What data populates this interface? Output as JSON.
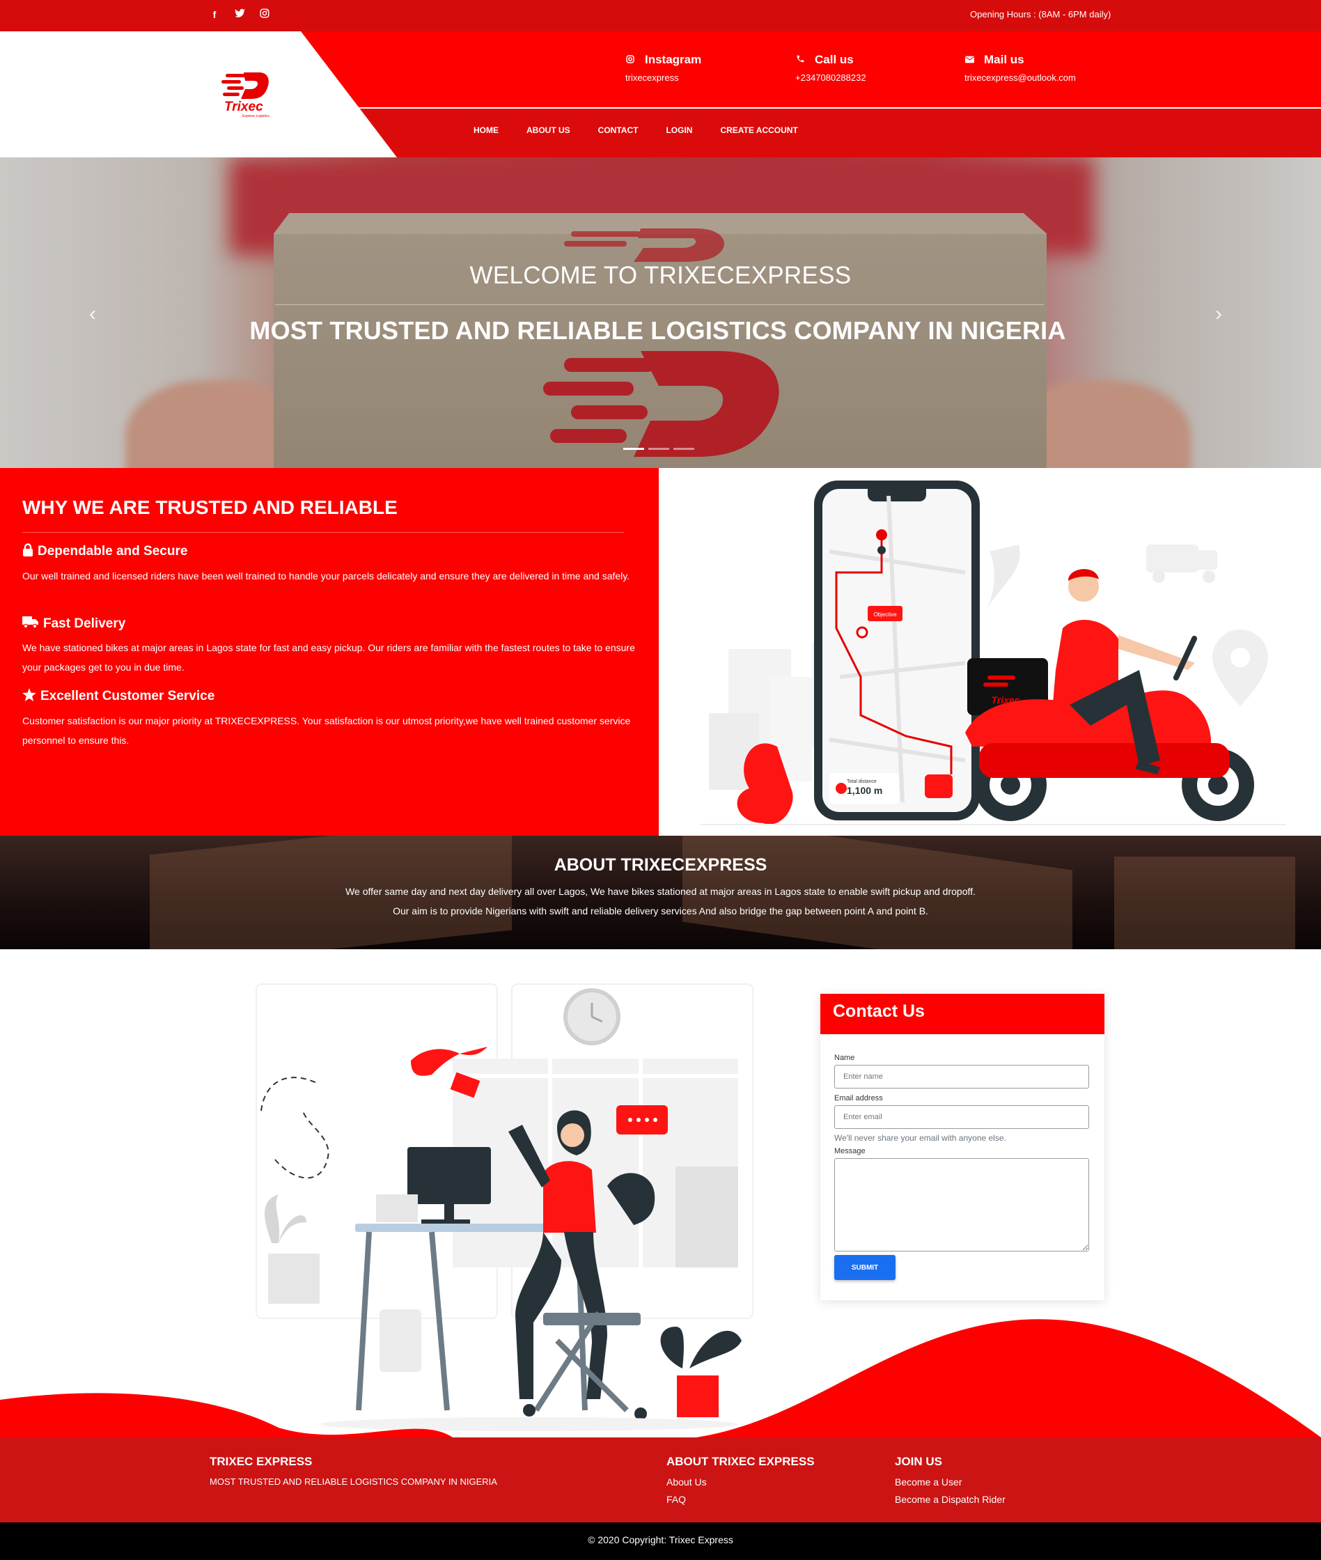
{
  "topbar": {
    "socials": [
      "facebook-icon",
      "twitter-icon",
      "instagram-icon"
    ],
    "opening_hours": "Opening Hours : (8AM - 6PM daily)"
  },
  "brand": {
    "name": "Trixec",
    "tagline": "Express Logistics"
  },
  "contacts": [
    {
      "icon": "instagram-icon",
      "title": "Instagram",
      "value": "trixecexpress"
    },
    {
      "icon": "phone-icon",
      "title": "Call us",
      "value": "+2347080288232"
    },
    {
      "icon": "envelope-icon",
      "title": "Mail us",
      "value": "trixecexpress@outlook.com"
    }
  ],
  "nav": [
    "HOME",
    "ABOUT US",
    "CONTACT",
    "LOGIN",
    "CREATE ACCOUNT"
  ],
  "hero": {
    "title": "WELCOME TO TRIXECEXPRESS",
    "subtitle": "MOST TRUSTED AND RELIABLE LOGISTICS COMPANY IN NIGERIA",
    "prev": "‹",
    "next": "›",
    "active_slide": 1,
    "slide_count": 3
  },
  "why": {
    "title": "WHY WE ARE TRUSTED AND RELIABLE",
    "items": [
      {
        "icon": "lock-icon",
        "title": "Dependable and Secure",
        "text": "Our well trained and licensed riders have been well trained to handle your parcels delicately and ensure they are delivered in time and safely."
      },
      {
        "icon": "truck-icon",
        "title": "Fast Delivery",
        "text": "We have stationed bikes at major areas in Lagos state for fast and easy pickup. Our riders are familiar with the fastest routes to take to ensure your packages get to you in due time."
      },
      {
        "icon": "star-icon",
        "title": "Excellent Customer Service",
        "text": "Customer satisfaction is our major priority at TRIXECEXPRESS. Your satisfaction is our utmost priority,we have well trained customer service personnel to ensure this."
      }
    ],
    "illustration": {
      "label": "Objective",
      "distance_label": "Total distance",
      "distance": "1,100 m",
      "brand": "Trixec"
    }
  },
  "about": {
    "title": "ABOUT TRIXECEXPRESS",
    "line1": "We offer same day and next day delivery all over Lagos, We have bikes stationed at major areas in Lagos state to enable swift pickup and dropoff.",
    "line2": "Our aim is to provide Nigerians with swift and reliable delivery services And also bridge the gap between point A and point B."
  },
  "contact_form": {
    "title": "Contact Us",
    "name_label": "Name",
    "name_placeholder": "Enter name",
    "email_label": "Email address",
    "email_placeholder": "Enter email",
    "email_hint": "We'll never share your email with anyone else.",
    "message_label": "Message",
    "submit": "SUBMIT"
  },
  "footer": {
    "col1": {
      "title": "TRIXEC EXPRESS",
      "text": "MOST TRUSTED AND RELIABLE LOGISTICS COMPANY IN NIGERIA"
    },
    "col2": {
      "title": "ABOUT TRIXEC EXPRESS",
      "links": [
        "About Us",
        "FAQ"
      ]
    },
    "col3": {
      "title": "JOIN US",
      "links": [
        "Become a User",
        "Become a Dispatch Rider"
      ]
    },
    "copyright": "© 2020 Copyright: Trixec Express"
  },
  "colors": {
    "brand_red": "#ff0000",
    "dark_red": "#d60b0b",
    "footer_red": "#cc1414",
    "submit_blue": "#1a6ff0"
  }
}
